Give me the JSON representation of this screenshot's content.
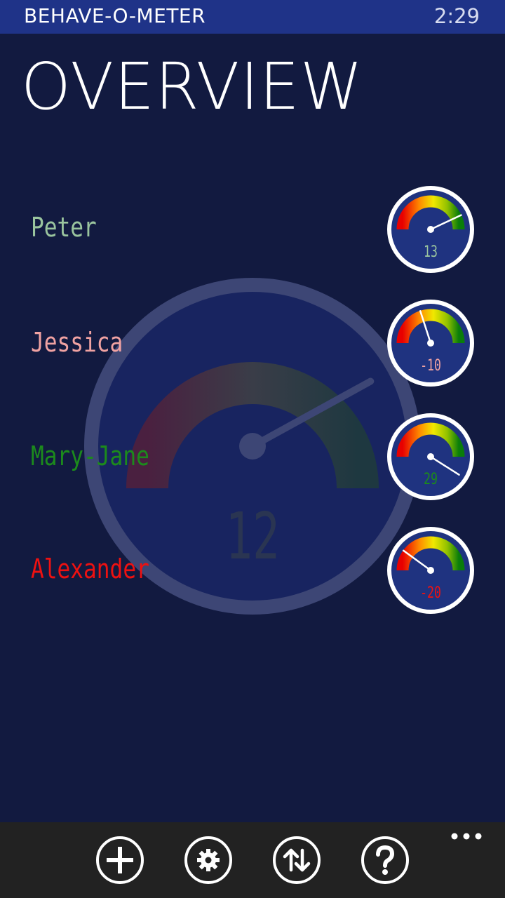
{
  "status": {
    "app_name": "BEHAVE-O-METER",
    "time": "2:29"
  },
  "page": {
    "title": "OVERVIEW"
  },
  "overall": {
    "value": 12
  },
  "kids": [
    {
      "name": "Peter",
      "score": 13,
      "name_color": "#9ac49e",
      "score_color": "#9ac49e"
    },
    {
      "name": "Jessica",
      "score": -10,
      "name_color": "#f0a2a2",
      "score_color": "#f0a2a2"
    },
    {
      "name": "Mary-Jane",
      "score": 29,
      "name_color": "#1c8a1c",
      "score_color": "#1c8a1c"
    },
    {
      "name": "Alexander",
      "score": -20,
      "name_color": "#ee1111",
      "score_color": "#ee1111"
    }
  ],
  "appbar": {
    "buttons": [
      {
        "label": "add",
        "icon": "plus-icon"
      },
      {
        "label": "settings",
        "icon": "gear-icon"
      },
      {
        "label": "sort",
        "icon": "sort-arrows-icon"
      },
      {
        "label": "help",
        "icon": "question-icon"
      }
    ],
    "more_icon": "ellipsis-icon"
  },
  "colors": {
    "background": "#121a40",
    "status_bar": "#1f3388",
    "gauge_face": "#1f3380",
    "app_bar": "#222222"
  }
}
